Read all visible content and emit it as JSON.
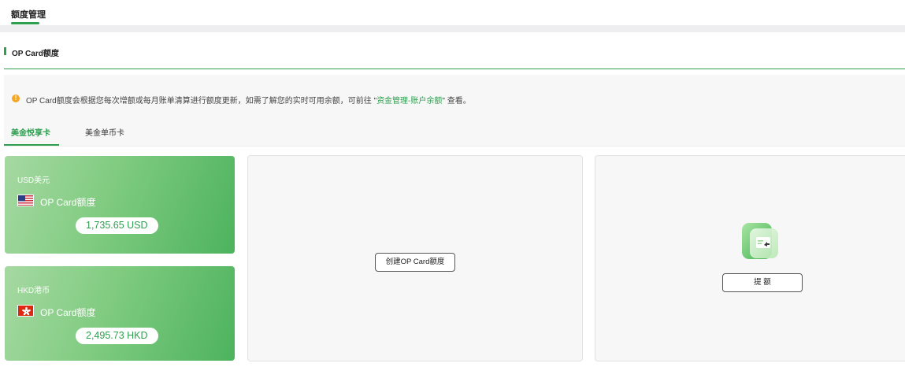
{
  "top_tabs": [
    {
      "label": "额度管理",
      "active": true
    }
  ],
  "section": {
    "title": "OP Card额度"
  },
  "notice": {
    "icon": "warning-icon",
    "text_before": "OP Card额度会根据您每次增额或每月账单清算进行额度更新，如需了解您的实时可用余额，可前往 \"",
    "link_text": "资金管理-账户余额",
    "text_after": "\" 查看。"
  },
  "card_tabs": [
    {
      "label": "美金悦享卡",
      "active": true
    },
    {
      "label": "美金单币卡",
      "active": false
    }
  ],
  "balances": [
    {
      "currency": "USD美元",
      "flag_icon": "us-flag-icon",
      "label": "OP Card额度",
      "amount": "1,735.65 USD"
    },
    {
      "currency": "HKD港币",
      "flag_icon": "hk-flag-icon",
      "label": "OP Card额度",
      "amount": "2,495.73 HKD"
    }
  ],
  "actions": {
    "create_label": "创建OP Card额度",
    "withdraw_label": "提 额",
    "withdraw_icon": "withdraw-card-icon"
  },
  "colors": {
    "accent": "#2e9e4f",
    "card_gradient_start": "#a6d9a2",
    "card_gradient_end": "#4db35d",
    "notice_icon": "#f5a623"
  }
}
